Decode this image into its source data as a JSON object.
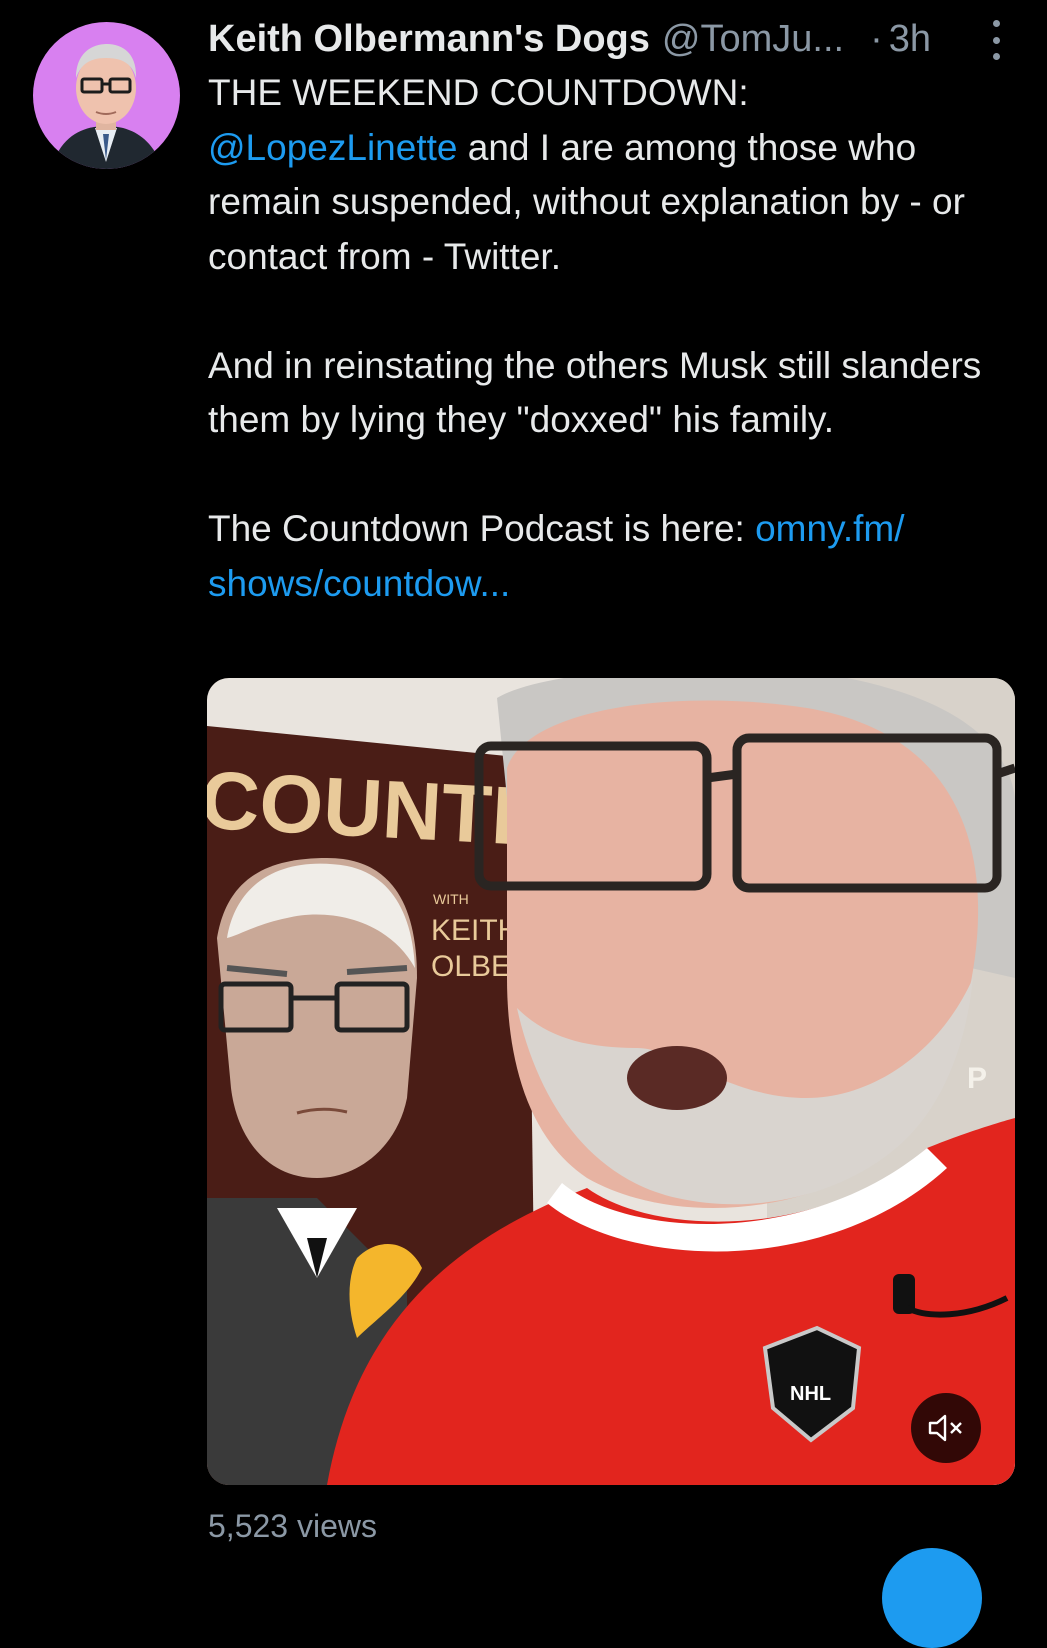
{
  "tweet": {
    "display_name": "Keith Olbermann's Dogs",
    "handle": "@TomJu...",
    "separator": "·",
    "time": "3h",
    "body": {
      "line1": "THE WEEKEND COUNTDOWN:",
      "mention": "@LopezLinette",
      "line2_rest": " and I are among those who remain suspended, without explanation by - or contact from - Twitter.",
      "paragraph2": "And in reinstating the others Musk still slanders them by lying they \"doxxed\" his family.",
      "paragraph3_prefix": "The Countdown Podcast is here: ",
      "link_text": "omny.fm/ shows/countdow..."
    },
    "views": "5,523 views"
  },
  "media": {
    "poster_title": "COUNTDOWN",
    "poster_with": "WITH",
    "poster_name_1": "KEITH",
    "poster_name_2": "OLBE",
    "jersey_logo": "NHL",
    "right_letter": "P"
  },
  "colors": {
    "background": "#000000",
    "text": "#e7e9ea",
    "secondary": "#8b98a5",
    "link": "#1d9bf0",
    "avatar_ring": "#d880f0",
    "jersey": "#e2251e"
  },
  "icons": {
    "mute": "speaker-muted-icon",
    "more": "vertical-ellipsis-icon"
  }
}
